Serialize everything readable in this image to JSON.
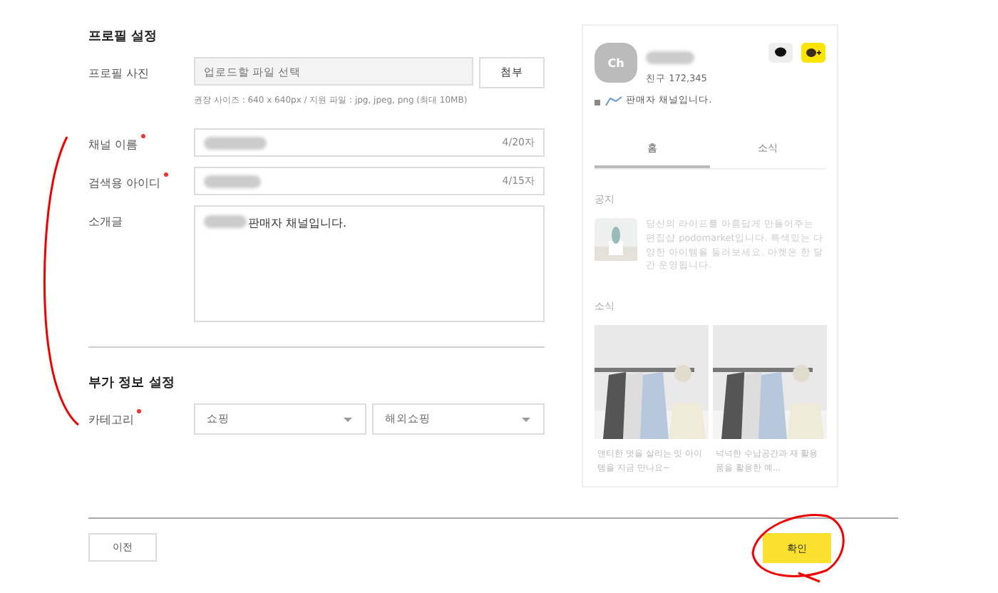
{
  "profile_section": {
    "title": "프로필 설정",
    "photo": {
      "label": "프로필 사진",
      "placeholder": "업로드할 파일 선택",
      "attach_button": "첨부",
      "hint": "권장 사이즈 : 640 x 640px / 지원 파일 : jpg, jpeg, png (최대 10MB)"
    },
    "channel_name": {
      "label": "채널 이름",
      "required": true,
      "counter": "4/20자"
    },
    "search_id": {
      "label": "검색용 아이디",
      "required": true,
      "counter": "4/15자"
    },
    "intro": {
      "label": "소개글",
      "value": "판매자 채널입니다."
    }
  },
  "extra_section": {
    "title": "부가 정보 설정",
    "category": {
      "label": "카테고리",
      "required": true,
      "selects": [
        "쇼핑",
        "해외쇼핑"
      ]
    }
  },
  "preview": {
    "avatar": "Ch",
    "friends": "친구 172,345",
    "description": "판매자 채널입니다.",
    "tabs": [
      {
        "label": "홈",
        "selected": true
      },
      {
        "label": "소식",
        "selected": false
      }
    ],
    "notice_title": "공지",
    "notice_text": "당신의 라이프를 아름답게 만들어주는 편집샵 podomarket입니다. 특색있는 다양한 아이템을 둘러보세요. 마켓은 한 달간 운영됩니다.",
    "news_title": "소식",
    "news": [
      {
        "kind": "picture",
        "text": "앤티한 멋을 살리는 잇 아이템을 지금 만나요~"
      },
      {
        "kind": "picture",
        "text": "넉넉한 수납공간과 재 활용품을 활용한 예..."
      }
    ]
  },
  "buttons": {
    "back": "이전",
    "confirm": "확인"
  }
}
